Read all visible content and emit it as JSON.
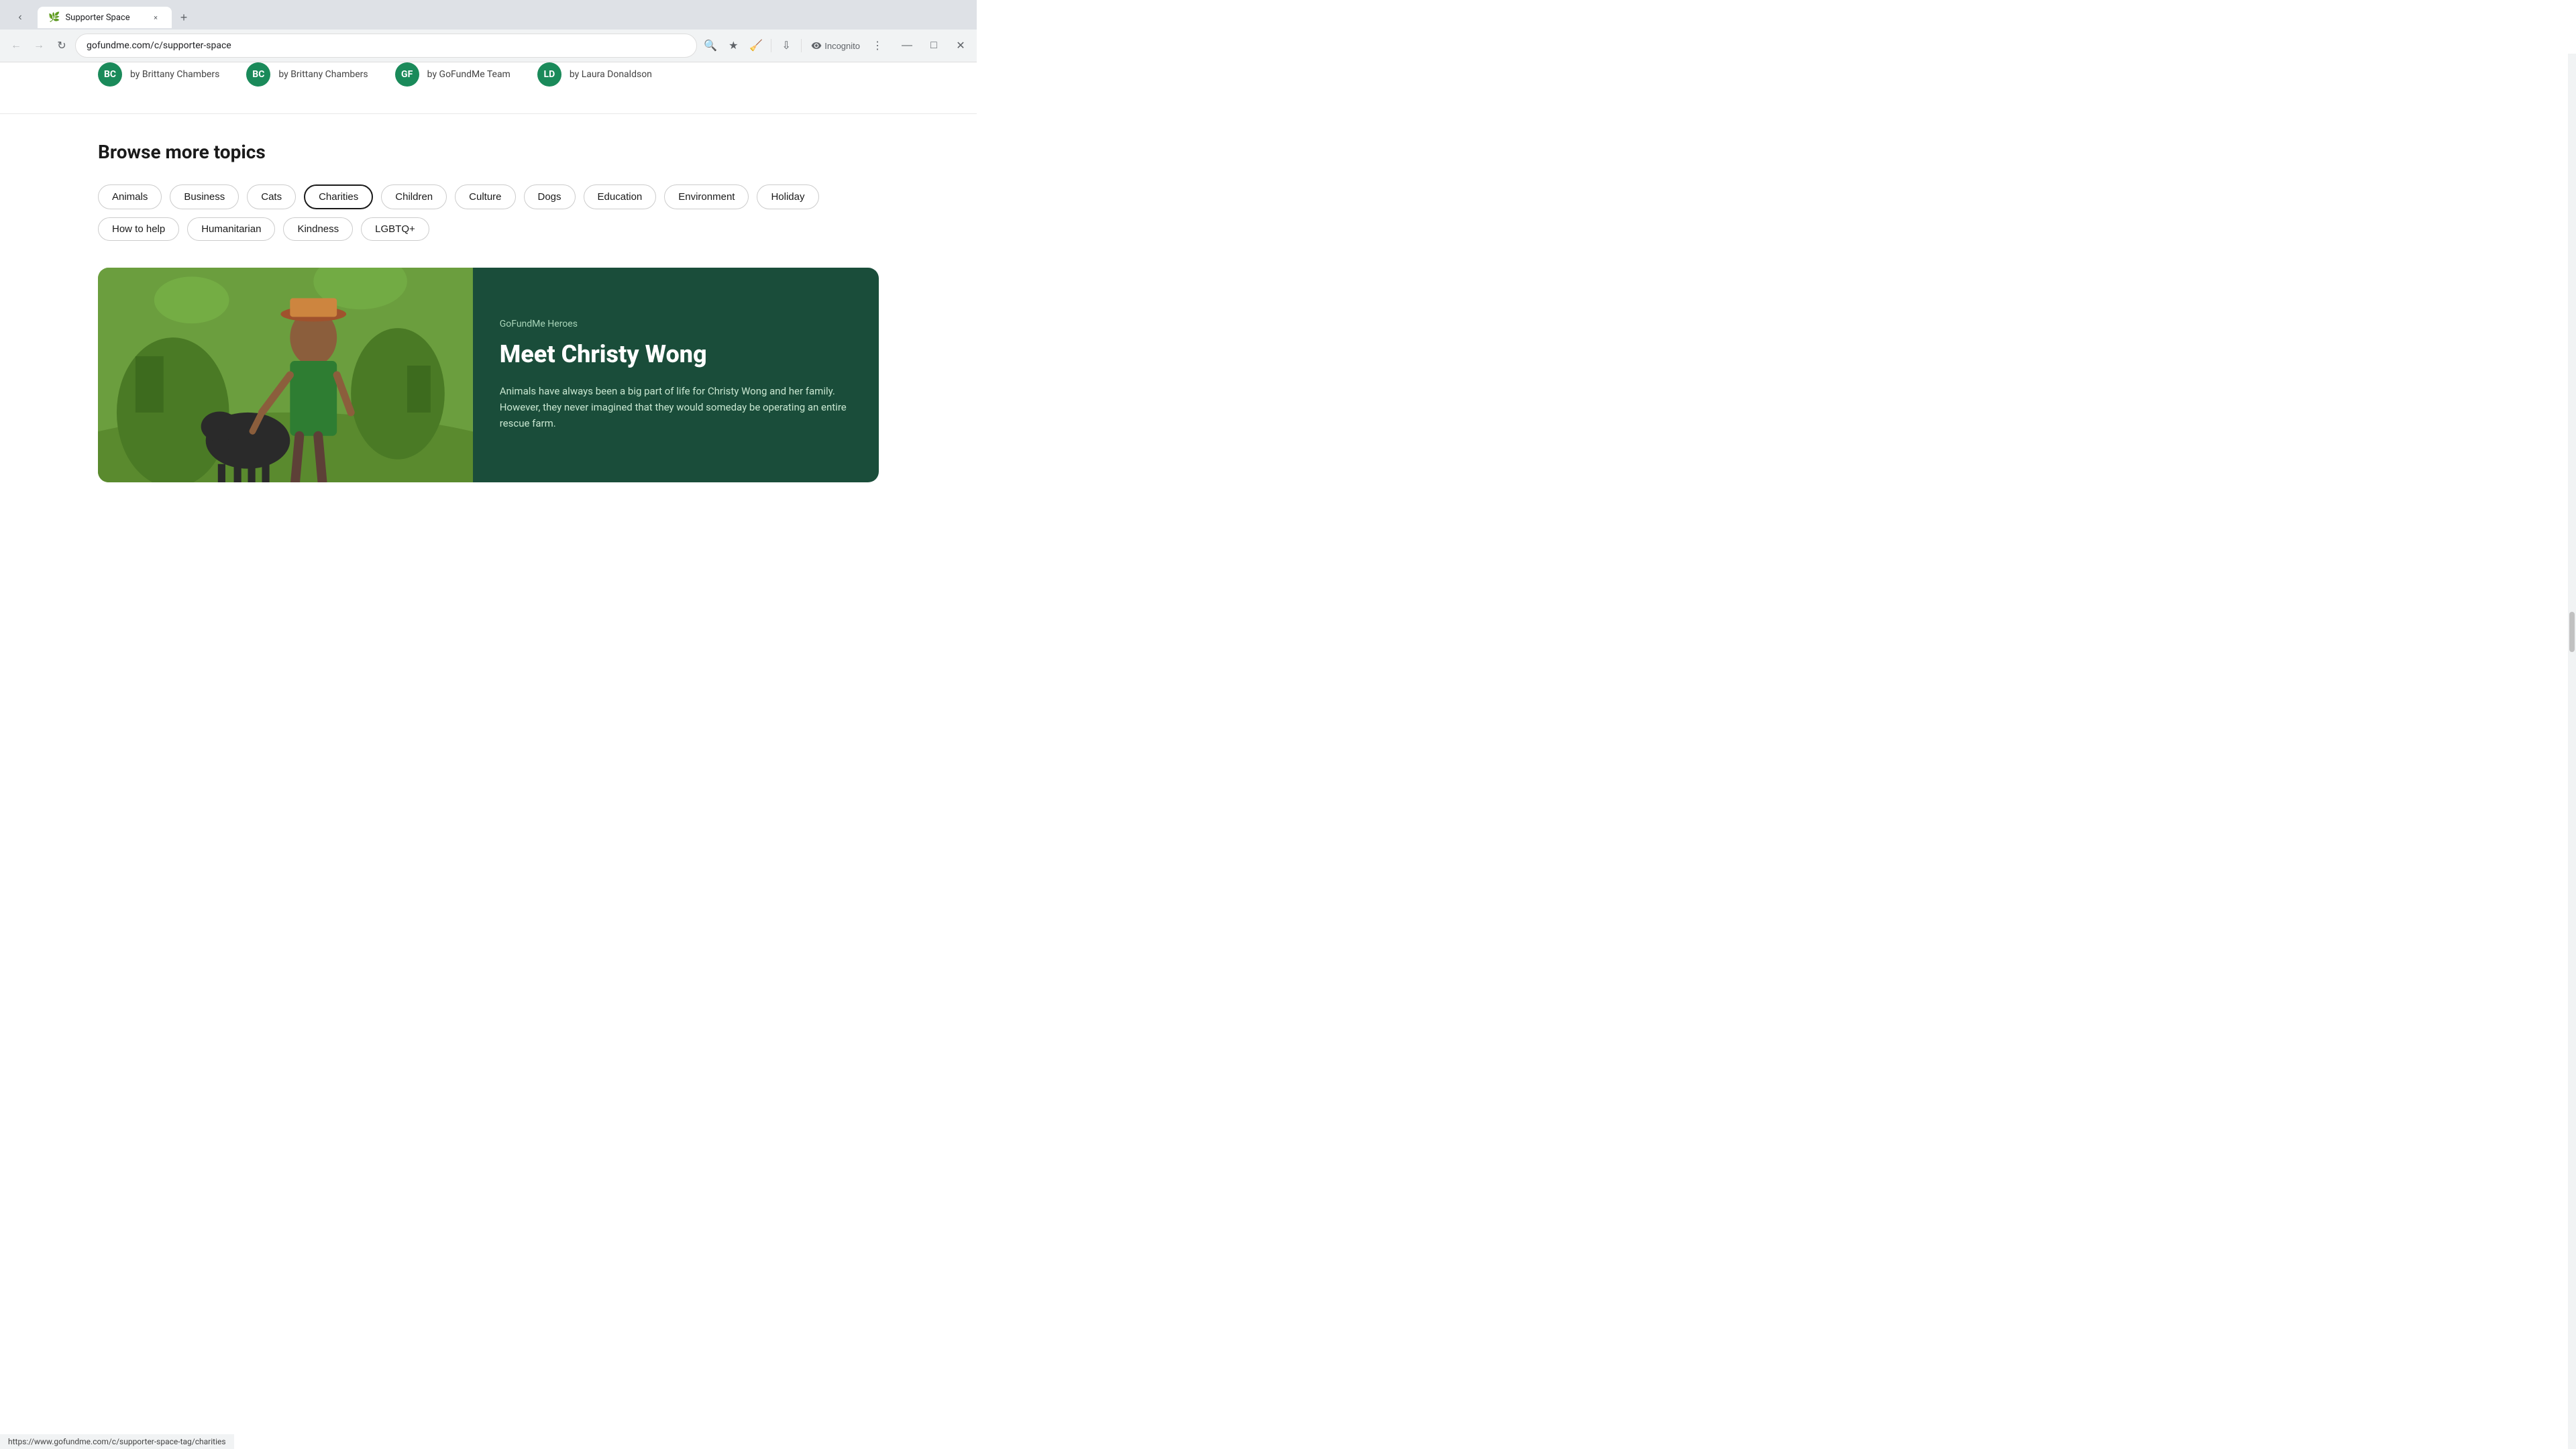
{
  "browser": {
    "tab_title": "Supporter Space",
    "tab_icon": "🌿",
    "url": "gofundme.com/c/supporter-space",
    "new_tab_label": "+",
    "close_tab_label": "×",
    "back_btn": "←",
    "forward_btn": "→",
    "reload_btn": "↻",
    "incognito_label": "Incognito",
    "minimize_label": "—",
    "maximize_label": "□",
    "close_label": "✕"
  },
  "authors": [
    {
      "id": "a1",
      "name": "by Brittany Chambers",
      "initials": "BC"
    },
    {
      "id": "a2",
      "name": "by Brittany Chambers",
      "initials": "BC"
    },
    {
      "id": "a3",
      "name": "by GoFundMe Team",
      "initials": "GF"
    },
    {
      "id": "a4",
      "name": "by Laura Donaldson",
      "initials": "LD"
    }
  ],
  "browse": {
    "title": "Browse more topics",
    "topics": [
      {
        "id": "animals",
        "label": "Animals",
        "active": false
      },
      {
        "id": "business",
        "label": "Business",
        "active": false
      },
      {
        "id": "cats",
        "label": "Cats",
        "active": false
      },
      {
        "id": "charities",
        "label": "Charities",
        "active": true
      },
      {
        "id": "children",
        "label": "Children",
        "active": false
      },
      {
        "id": "culture",
        "label": "Culture",
        "active": false
      },
      {
        "id": "dogs",
        "label": "Dogs",
        "active": false
      },
      {
        "id": "education",
        "label": "Education",
        "active": false
      },
      {
        "id": "environment",
        "label": "Environment",
        "active": false
      },
      {
        "id": "holiday",
        "label": "Holiday",
        "active": false
      },
      {
        "id": "how-to-help",
        "label": "How to help",
        "active": false
      },
      {
        "id": "humanitarian",
        "label": "Humanitarian",
        "active": false
      },
      {
        "id": "kindness",
        "label": "Kindness",
        "active": false
      },
      {
        "id": "lgbtq",
        "label": "LGBTQ+",
        "active": false
      }
    ]
  },
  "hero": {
    "tag": "GoFundMe Heroes",
    "title": "Meet Christy Wong",
    "description": "Animals have always been a big part of life for Christy Wong and her family. However, they never imagined that they would someday be operating an entire rescue farm.",
    "bg_color": "#1a4d3a"
  },
  "status_bar": {
    "url": "https://www.gofundme.com/c/supporter-space-tag/charities"
  }
}
